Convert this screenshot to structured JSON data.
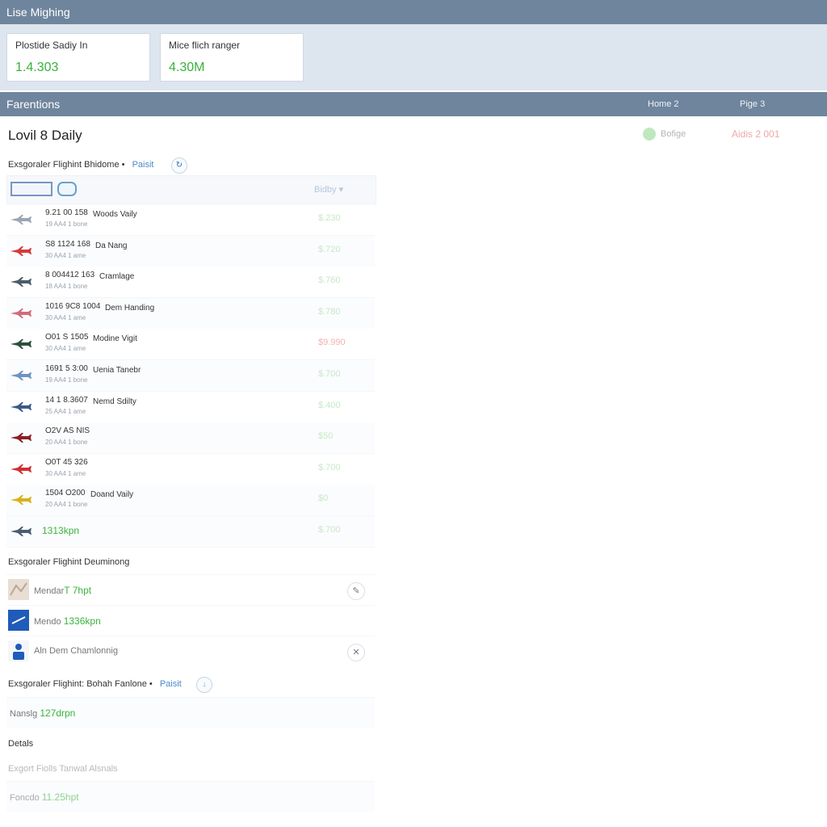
{
  "app": {
    "title": "Lise Mighing"
  },
  "stats": [
    {
      "label": "Plostide Sadiy In",
      "value": "1.4.303"
    },
    {
      "label": "Mice flich ranger",
      "value": "4.30M"
    }
  ],
  "nav": {
    "title": "Farentions",
    "links": [
      "Home 2",
      "Pige 3"
    ]
  },
  "page": {
    "title": "Lovil 8 Daily",
    "status_badge": "Bofige",
    "status_right": "Aidis 2 001"
  },
  "section1": {
    "heading": "Exsgoraler Flighint Bhidome",
    "separator": "•",
    "link": "Paisit",
    "column_sort": "Bidby"
  },
  "flights": [
    {
      "code": "9.21 00 158",
      "dest": "Woods Vaily",
      "sub": "19 AA4 1 bone",
      "price": "$.230",
      "plane_color": "#9aa6b5",
      "status": "green"
    },
    {
      "code": "S8 1124 168",
      "dest": "Da Nang",
      "sub": "30 AA4 1 ame",
      "price": "$.720",
      "plane_color": "#d43b3b",
      "status": "green"
    },
    {
      "code": "8 004412 163",
      "dest": "Cramlage",
      "sub": "18 AA4 1 bone",
      "price": "$.760",
      "plane_color": "#4b5b6b",
      "status": "green"
    },
    {
      "code": "1016 9C8 1004",
      "dest": "Dem Handing",
      "sub": "30 AA4 1 ame",
      "price": "$.780",
      "plane_color": "#d46b7a",
      "status": "green"
    },
    {
      "code": "O01 S 1505",
      "dest": "Modine Vigit",
      "sub": "30 AA4 1 ame",
      "price": "$9.990",
      "plane_color": "#2d4e3e",
      "status": "red"
    },
    {
      "code": "1691 5 3:00",
      "dest": "Uenia Tanebr",
      "sub": "19 AA4 1 bone",
      "price": "$.700",
      "plane_color": "#6a94c3",
      "status": "green"
    },
    {
      "code": "14 1 8.3607",
      "dest": "Nemd Sdilty",
      "sub": "25 AA4 1 ame",
      "price": "$.400",
      "plane_color": "#3d5a87",
      "status": "green"
    },
    {
      "code": "O2V AS NIS",
      "dest": "",
      "sub": "20 AA4 1 bone",
      "price": "$50",
      "plane_color": "#8b1f23",
      "status": "green"
    },
    {
      "code": "O0T 45 326",
      "dest": "",
      "sub": "30 AA4 1 ame",
      "price": "$.700",
      "plane_color": "#d02f33",
      "status": "green"
    },
    {
      "code": "1504 O200",
      "dest": "Doand Vaily",
      "sub": "20 AA4 1 bone",
      "price": "$0",
      "plane_color": "#d9b21b",
      "status": "green"
    }
  ],
  "flight_total": {
    "label": "1313kpn",
    "price": "$.700",
    "plane_color": "#4a5c70"
  },
  "section2": {
    "heading": "Exsgoraler Flighint Deuminong",
    "rows": [
      {
        "prefix": "Mendar",
        "value": "T 7hpt",
        "action_icon": "edit-icon"
      },
      {
        "prefix": "Mendo",
        "value": "1336kpn",
        "action_icon": ""
      },
      {
        "prefix": "Aln Dem Chamlonnig",
        "value": "",
        "action_icon": "close-icon"
      }
    ]
  },
  "section3": {
    "heading": "Exsgoraler Flighint: Bohah Fanlone",
    "separator": "•",
    "link": "Paisit",
    "row": {
      "prefix": "Nanslg",
      "value": "127drpn"
    }
  },
  "details": {
    "heading": "Detals",
    "subheading": "Exgort Fiolls Tanwal Alsnals",
    "row": {
      "prefix": "Foncdo",
      "value": "11.25hpt"
    }
  },
  "colors": {
    "header": "#6f859d",
    "band": "#dde5ee",
    "green": "#38b13a",
    "red": "#e06060",
    "link": "#4a88c7"
  }
}
